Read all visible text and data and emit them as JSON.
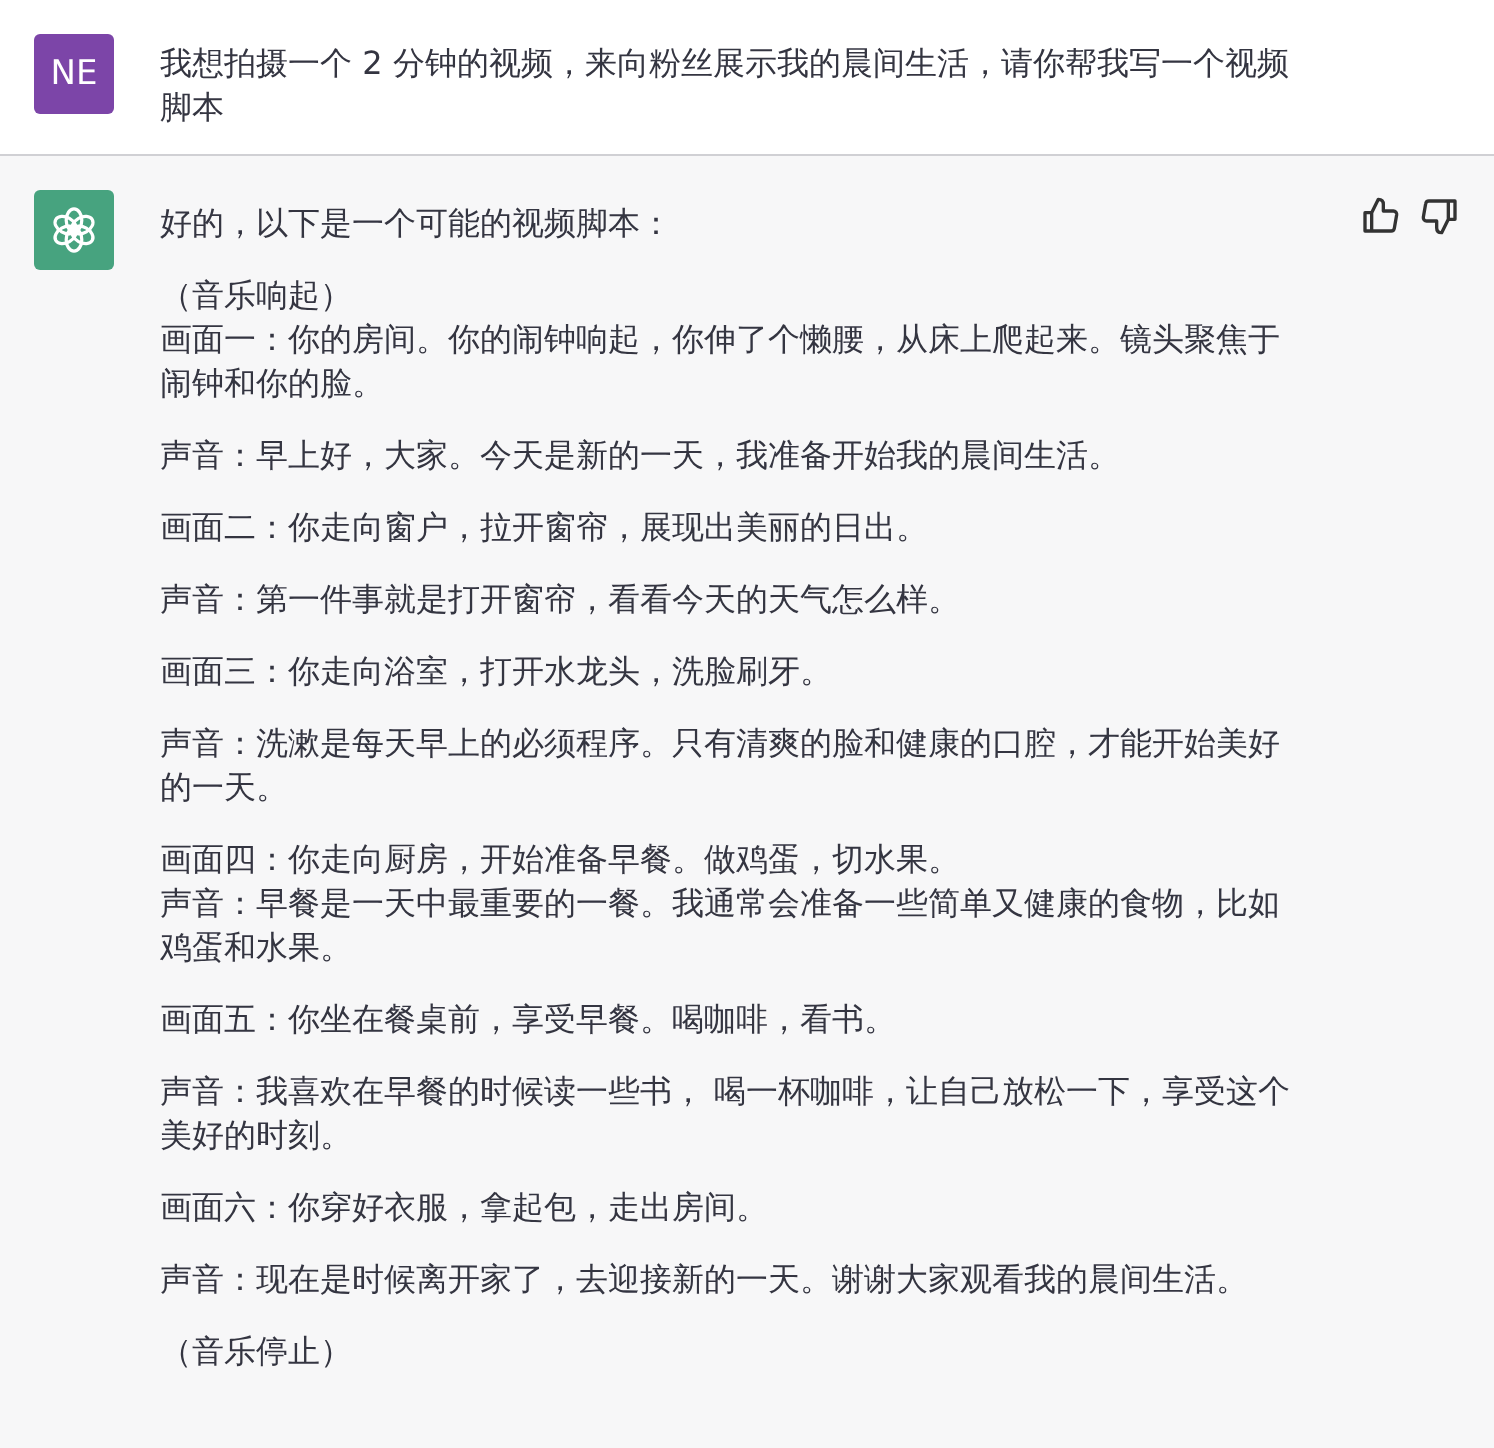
{
  "user_message": {
    "avatar": "NE",
    "text": "我想拍摄一个 2 分钟的视频，来向粉丝展示我的晨间生活，请你帮我写一个视频脚本"
  },
  "assistant_message": {
    "paragraphs": [
      [
        "好的，以下是一个可能的视频脚本："
      ],
      [
        "（音乐响起）",
        "画面一：你的房间。你的闹钟响起，你伸了个懒腰，从床上爬起来。镜头聚焦于闹钟和你的脸。"
      ],
      [
        "声音：早上好，大家。今天是新的一天，我准备开始我的晨间生活。"
      ],
      [
        "画面二：你走向窗户，拉开窗帘，展现出美丽的日出。"
      ],
      [
        "声音：第一件事就是打开窗帘，看看今天的天气怎么样。"
      ],
      [
        "画面三：你走向浴室，打开水龙头，洗脸刷牙。"
      ],
      [
        "声音：洗漱是每天早上的必须程序。只有清爽的脸和健康的口腔，才能开始美好的一天。"
      ],
      [
        "画面四：你走向厨房，开始准备早餐。做鸡蛋，切水果。",
        "声音：早餐是一天中最重要的一餐。我通常会准备一些简单又健康的食物，比如鸡蛋和水果。"
      ],
      [
        "画面五：你坐在餐桌前，享受早餐。喝咖啡，看书。"
      ],
      [
        "声音：我喜欢在早餐的时候读一些书， 喝一杯咖啡，让自己放松一下，享受这个美好的时刻。"
      ],
      [
        "画面六：你穿好衣服，拿起包，走出房间。"
      ],
      [
        "声音：现在是时候离开家了，去迎接新的一天。谢谢大家观看我的晨间生活。"
      ],
      [
        "（音乐停止）"
      ]
    ]
  }
}
